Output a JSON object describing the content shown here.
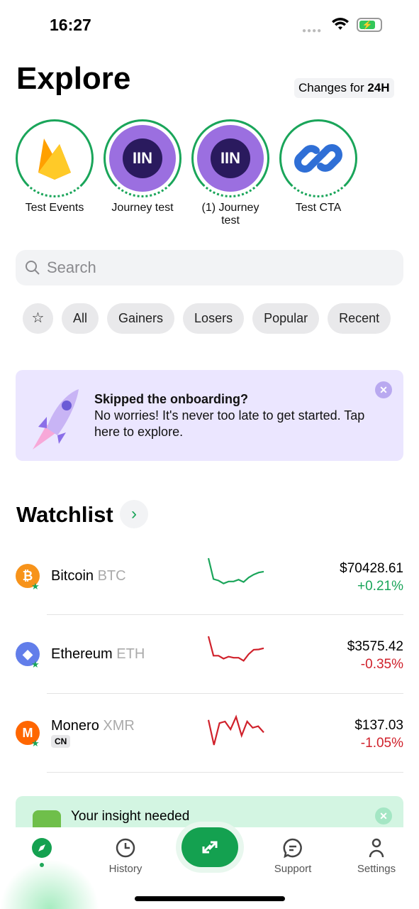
{
  "status": {
    "time": "16:27"
  },
  "header": {
    "title": "Explore",
    "changes_prefix": "Changes for ",
    "changes_period": "24H"
  },
  "stories": [
    {
      "label": "Test Events",
      "icon": "firebase-icon"
    },
    {
      "label": "Journey test",
      "icon": "journey-logo-icon"
    },
    {
      "label": "(1) Journey test",
      "icon": "journey-logo-icon"
    },
    {
      "label": "Test CTA",
      "icon": "link-icon"
    }
  ],
  "search": {
    "placeholder": "Search"
  },
  "filters": [
    "All",
    "Gainers",
    "Losers",
    "Popular",
    "Recent"
  ],
  "banner": {
    "title": "Skipped the onboarding?",
    "body": "No worries! It's never too late to get started. Tap here to explore."
  },
  "watchlist": {
    "title": "Watchlist",
    "items": [
      {
        "name": "Bitcoin",
        "symbol": "BTC",
        "price": "$70428.61",
        "change": "+0.21%",
        "trend": "up",
        "color": "#f7931a",
        "sparkline": [
          100,
          30,
          25,
          15,
          22,
          22,
          28,
          20,
          35,
          45,
          52,
          55
        ]
      },
      {
        "name": "Ethereum",
        "symbol": "ETH",
        "price": "$3575.42",
        "change": "-0.35%",
        "trend": "down",
        "color": "#627eea",
        "sparkline": [
          100,
          35,
          35,
          25,
          32,
          28,
          28,
          18,
          40,
          55,
          56,
          60
        ]
      },
      {
        "name": "Monero",
        "symbol": "XMR",
        "price": "$137.03",
        "change": "-1.05%",
        "trend": "down",
        "color": "#ff6600",
        "badge": "CN",
        "sparkline": [
          80,
          0,
          70,
          75,
          50,
          90,
          30,
          75,
          55,
          60,
          40
        ]
      }
    ]
  },
  "insight": {
    "title": "Your insight needed"
  },
  "colors": {
    "up": "#1aa55a",
    "down": "#d0212b",
    "accent": "#14a150"
  },
  "tabs": [
    {
      "label": "",
      "icon": "compass-icon",
      "active": true
    },
    {
      "label": "History",
      "icon": "clock-icon"
    },
    {
      "label": "",
      "icon": "swap-icon"
    },
    {
      "label": "Support",
      "icon": "chat-icon"
    },
    {
      "label": "Settings",
      "icon": "person-icon"
    }
  ]
}
